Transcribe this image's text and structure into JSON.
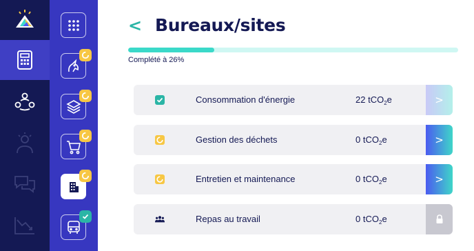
{
  "rail": {
    "items": [
      {
        "name": "logo"
      },
      {
        "name": "calculator",
        "active": true
      },
      {
        "name": "community"
      },
      {
        "name": "ideas"
      },
      {
        "name": "chat"
      },
      {
        "name": "trends"
      }
    ]
  },
  "sidebar": {
    "tiles": [
      {
        "name": "grid",
        "status": "none"
      },
      {
        "name": "unicorn",
        "status": "pending"
      },
      {
        "name": "layers",
        "status": "pending"
      },
      {
        "name": "cart",
        "status": "pending"
      },
      {
        "name": "building",
        "status": "pending",
        "active": true
      },
      {
        "name": "bus",
        "status": "done"
      }
    ]
  },
  "header": {
    "back_label": "<",
    "title": "Bureaux/sites"
  },
  "progress": {
    "percent": 26,
    "label": "Complété à 26%"
  },
  "rows": [
    {
      "label": "Consommation d'énergie",
      "value": "22",
      "unit_pre": "tCO",
      "unit_sub": "2",
      "unit_post": "e",
      "status": "done",
      "button": ">",
      "button_state": "faded"
    },
    {
      "label": "Gestion des déchets",
      "value": "0",
      "unit_pre": "tCO",
      "unit_sub": "2",
      "unit_post": "e",
      "status": "pending",
      "button": ">",
      "button_state": "active"
    },
    {
      "label": "Entretien et maintenance",
      "value": "0",
      "unit_pre": "tCO",
      "unit_sub": "2",
      "unit_post": "e",
      "status": "pending",
      "button": ">",
      "button_state": "active"
    },
    {
      "label": "Repas au travail",
      "value": "0",
      "unit_pre": "tCO",
      "unit_sub": "2",
      "unit_post": "e",
      "status": "group",
      "button": "lock",
      "button_state": "locked"
    }
  ],
  "colors": {
    "rail_bg": "#141954",
    "sidebar_bg": "#3737c0",
    "accent_teal": "#2bb5a6",
    "pending_yellow": "#f7c744",
    "text_navy": "#141954"
  }
}
